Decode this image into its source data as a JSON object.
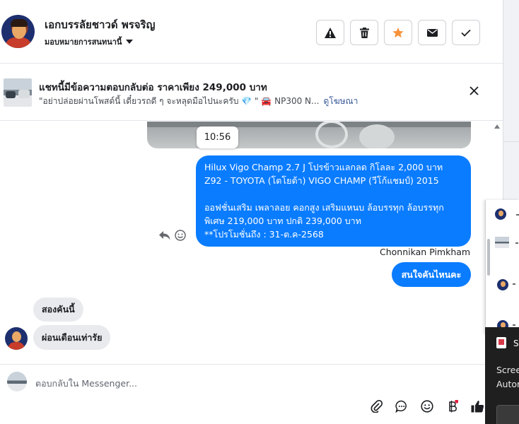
{
  "header": {
    "contact_name": "เอกบรรลัยชาวด์ พรจริญ",
    "assign_label": "มอบหมายการสนทนานี้",
    "buttons": [
      {
        "icon": "warning-icon"
      },
      {
        "icon": "trash-icon"
      },
      {
        "icon": "star-icon",
        "color": "#f7923b"
      },
      {
        "icon": "mail-icon"
      },
      {
        "icon": "check-icon"
      }
    ]
  },
  "banner": {
    "title": "แชทนี้มีข้อความตอบกลับต่อ ราคาเพียง 249,000 บาท",
    "subtitle": "\"อย่าปล่อยผ่านโพสต์นี้ เดี๋ยวรถดี ๆ จะหลุดมือไปนะครับ 💎 \" 🚘 NP300 N...",
    "link": "ดูโฆษณา"
  },
  "chat": {
    "time_label": "10:56",
    "outgoing_main": {
      "lines": [
        "Hilux Vigo Champ 2.7 J โปรข้าวแลกลด กิโลละ 2,000 บาท",
        "Z92 - TOYOTA (โตโยต้า) VIGO CHAMP (วีโก้แชมป์) 2015",
        "",
        " ออฟชั่นเสริม เพลาลอย คอกสูง เสริมแหนบ ล้อบรรทุก ล้อบรรทุก",
        "พิเศษ 219,000 บาท  ปกติ 239,000 บาท",
        "**โปรโมชั่นถึง : 31-ต.ค-2568"
      ]
    },
    "sender_name": "Chonnikan Pimkham",
    "outgoing_short": "สนใจคันไหนคะ",
    "incoming": [
      "สองคันนี้",
      "ผ่อนเดือนเท่ารัย"
    ],
    "colors": {
      "outgoing": "#0a7cff",
      "incoming": "#e9eaed"
    }
  },
  "composer": {
    "placeholder": "ตอบกลับใน Messenger..."
  },
  "side_panel": {
    "title": "S",
    "line1": "Scree",
    "line2": "Autor"
  }
}
